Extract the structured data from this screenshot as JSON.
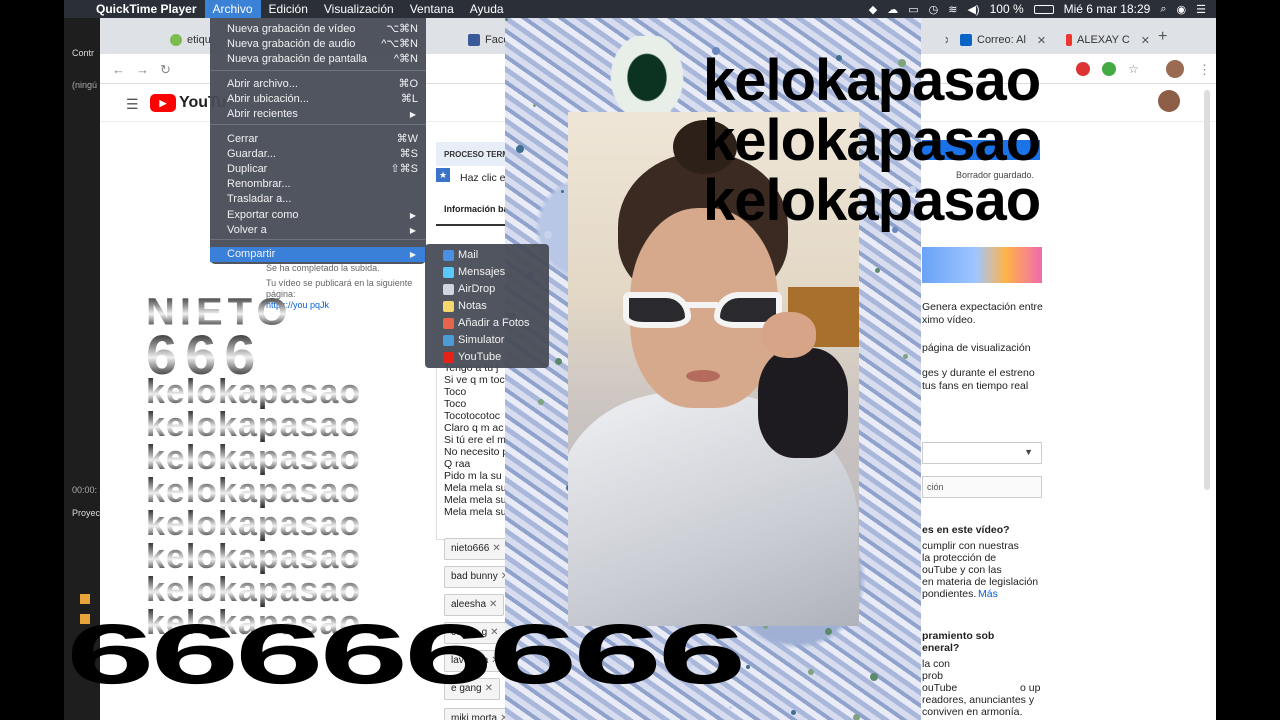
{
  "menubar": {
    "apple": "",
    "app_name": "QuickTime Player",
    "menus": [
      "Archivo",
      "Edición",
      "Visualización",
      "Ventana",
      "Ayuda"
    ],
    "battery": "100 %",
    "clock": "Mié 6 mar  18:29"
  },
  "left_panel": {
    "top_label": "Contr",
    "sub_label": "(ningú",
    "time_label": "00:00:",
    "proj_label": "Proyec"
  },
  "browser": {
    "tabs": [
      {
        "label": "etiqu"
      },
      {
        "label": "Face"
      },
      {
        "label": "Correo: Al"
      },
      {
        "label": "ALEXAY C"
      }
    ],
    "new_tab": "+"
  },
  "youtube": {
    "logo_text": "YouTu",
    "process_label": "PROCESO TERM",
    "click_hint": "Haz clic e",
    "info_tab": "Información bá",
    "draft_saved": "Borrador guardado.",
    "upload_done": "Se ha completado la subida.",
    "publish_note_1": "Tu vídeo se publicará en la siguiente",
    "publish_note_2": "página:",
    "video_link": "https://you              pqJk",
    "lyrics": [
      "Tengo a tu j",
      "Si ve q m toc",
      "Toco",
      "Toco",
      "Tocotocotoc",
      "Claro q m ac",
      "Si tú ere el m",
      "No necesito p",
      "Q raa",
      "Pido m la su",
      "Mela mela su",
      "Mela mela su",
      "Mela mela su"
    ],
    "tags": [
      "nieto666",
      "bad bunny",
      "aleesha",
      "cecilio g",
      "lavenida",
      "e gang",
      "miki morta"
    ],
    "right_texts": {
      "expect_1": "Genera expectación entre",
      "expect_2": "ximo vídeo.",
      "watch_page": "página de visualización",
      "premiere_1": "ges y durante el estreno",
      "premiere_2": "tus fans en tiempo real",
      "cion": "ción",
      "question": "es en este vídeo?",
      "legal_1": "cumplir con nuestras",
      "legal_2": "la protección de",
      "legal_3": "ouTube y con las",
      "legal_4": "en materia de legislación",
      "legal_5": "pondientes.",
      "more": "Más",
      "general_1": "pramiento sob",
      "general_2": "eneral?",
      "general_3": "la con",
      "general_4": "prob",
      "general_5": "ouTube",
      "general_6": "o up",
      "general_7": "readores, anunciantes y",
      "general_8": "conviven en armonía."
    }
  },
  "file_menu": {
    "items": [
      {
        "label": "Nueva grabación de vídeo",
        "shortcut": "⌥⌘N"
      },
      {
        "label": "Nueva grabación de audio",
        "shortcut": "^⌥⌘N"
      },
      {
        "label": "Nueva grabación de pantalla",
        "shortcut": "^⌘N"
      },
      {
        "label": "Abrir archivo...",
        "shortcut": "⌘O"
      },
      {
        "label": "Abrir ubicación...",
        "shortcut": "⌘L"
      },
      {
        "label": "Abrir recientes",
        "shortcut": "▶"
      },
      {
        "label": "Cerrar",
        "shortcut": "⌘W"
      },
      {
        "label": "Guardar...",
        "shortcut": "⌘S"
      },
      {
        "label": "Duplicar",
        "shortcut": "⇧⌘S"
      },
      {
        "label": "Renombrar...",
        "shortcut": ""
      },
      {
        "label": "Trasladar a...",
        "shortcut": ""
      },
      {
        "label": "Exportar como",
        "shortcut": "▶"
      },
      {
        "label": "Volver a",
        "shortcut": "▶"
      },
      {
        "label": "Compartir",
        "shortcut": "▶"
      }
    ]
  },
  "share_menu": {
    "items": [
      {
        "label": "Mail",
        "color": "#4a90e2"
      },
      {
        "label": "Mensajes",
        "color": "#5ac8fa"
      },
      {
        "label": "AirDrop",
        "color": "#cfd6df"
      },
      {
        "label": "Notas",
        "color": "#f5d76e"
      },
      {
        "label": "Añadir a Fotos",
        "color": "#e8644c"
      },
      {
        "label": "Simulator",
        "color": "#4a9bd6"
      },
      {
        "label": "YouTube",
        "color": "#e62117"
      }
    ]
  },
  "overlay": {
    "kelokapasao": "kelokapasao",
    "nieto": "NIETO",
    "six_three": "666",
    "bottom_sixes": "66666666"
  },
  "colors": {
    "menubar_bg": "#2b2f38",
    "menu_highlight": "#3a80d8",
    "youtube_red": "#ff0000",
    "youtube_blue": "#065fd4"
  }
}
